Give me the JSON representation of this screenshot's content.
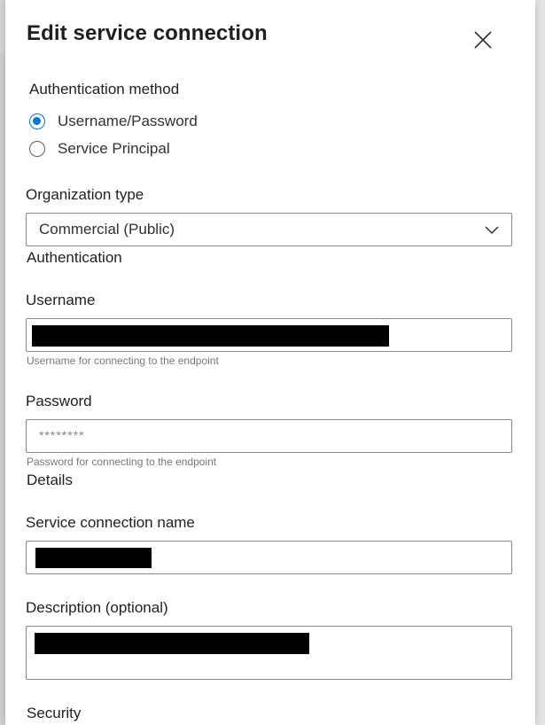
{
  "dialog": {
    "title": "Edit service connection",
    "close_icon": "close-icon"
  },
  "auth_method": {
    "label": "Authentication method",
    "options": [
      {
        "label": "Username/Password",
        "selected": true
      },
      {
        "label": "Service Principal",
        "selected": false
      }
    ]
  },
  "org_type": {
    "label": "Organization type",
    "value": "Commercial (Public)",
    "icon": "chevron-down-icon"
  },
  "authentication": {
    "section_title": "Authentication",
    "username": {
      "label": "Username",
      "hint": "Username for connecting to the endpoint"
    },
    "password": {
      "label": "Password",
      "placeholder": "********",
      "hint": "Password for connecting to the endpoint"
    }
  },
  "details": {
    "section_title": "Details",
    "name": {
      "label": "Service connection name"
    },
    "description": {
      "label": "Description (optional)"
    }
  },
  "security": {
    "section_title": "Security"
  },
  "colors": {
    "accent": "#0078d4",
    "border": "#8a8886",
    "text": "#201f1e",
    "hint": "#797775"
  }
}
